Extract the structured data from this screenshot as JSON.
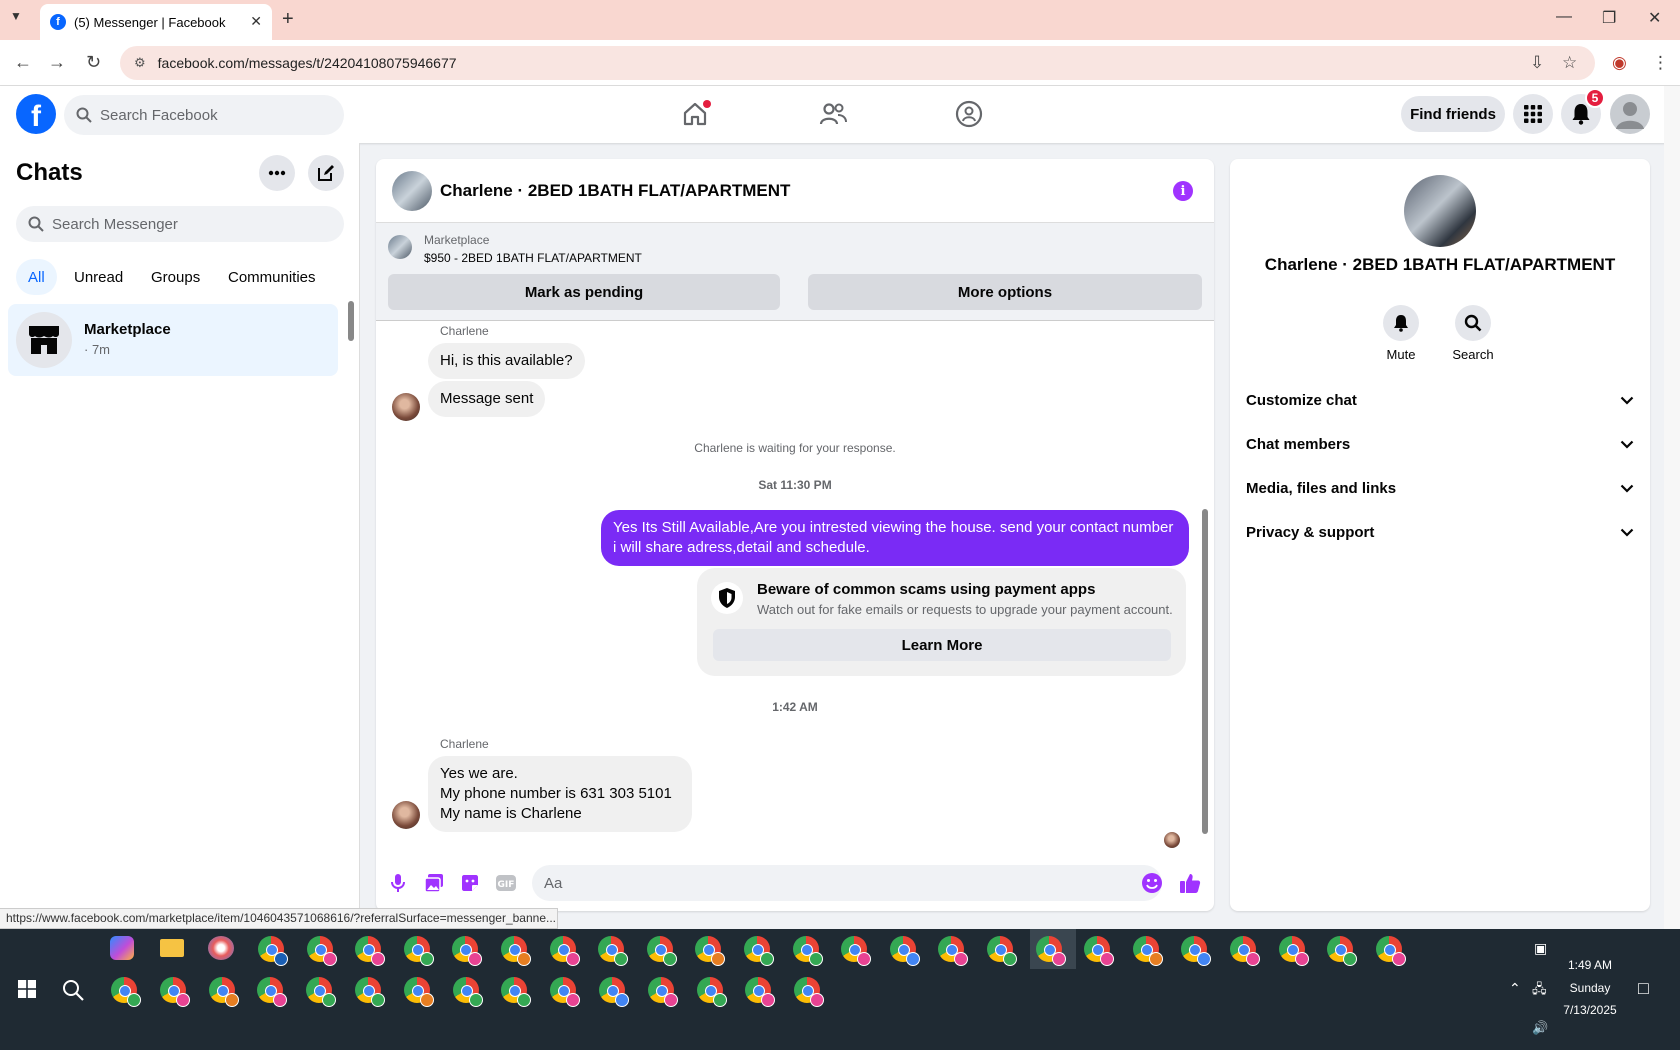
{
  "browser": {
    "tab_title": "(5) Messenger | Facebook",
    "url": "facebook.com/messages/t/24204108075946677",
    "status_url": "https://www.facebook.com/marketplace/item/1046043571068616/?referralSurface=messenger_banne..."
  },
  "fb_header": {
    "search_placeholder": "Search Facebook",
    "find_friends_label": "Find friends",
    "notification_count": "5"
  },
  "sidebar": {
    "title": "Chats",
    "search_placeholder": "Search Messenger",
    "filters": [
      "All",
      "Unread",
      "Groups",
      "Communities"
    ],
    "chat_item": {
      "name": "Marketplace",
      "time": "· 7m"
    }
  },
  "conversation": {
    "title": "Charlene · 2BED 1BATH FLAT/APARTMENT",
    "marketplace_label": "Marketplace",
    "listing": "$950 - 2BED 1BATH FLAT/APARTMENT",
    "mark_pending_label": "Mark as pending",
    "more_options_label": "More options",
    "sender_name": "Charlene",
    "msg1": "Hi, is this available?",
    "msg2": "Message sent",
    "waiting_notice": "Charlene is waiting for your response.",
    "stamp1": "Sat 11:30 PM",
    "out_msg": "Yes Its Still Available,Are you intrested viewing the house. send your contact number i will share adress,detail and schedule.",
    "warning_title": "Beware of common scams using payment apps",
    "warning_sub": "Watch out for fake emails or requests to upgrade your payment account.",
    "learn_more_label": "Learn More",
    "stamp2": "1:42 AM",
    "reply_line1": "Yes we are.",
    "reply_line2": "My phone number is 631 303 5101",
    "reply_line3": "My name is Charlene",
    "composer_placeholder": "Aa"
  },
  "right_panel": {
    "name": "Charlene · 2BED 1BATH FLAT/APARTMENT",
    "mute_label": "Mute",
    "search_label": "Search",
    "sections": [
      "Customize chat",
      "Chat members",
      "Media, files and links",
      "Privacy & support"
    ]
  },
  "taskbar": {
    "time": "1:49 AM",
    "day": "Sunday",
    "date": "7/13/2025"
  },
  "colors": {
    "fb_blue": "#0866ff",
    "messenger_purple": "#7a2bf5",
    "tab_bar": "#f9d7d0",
    "badge_red": "#e41e3f"
  }
}
